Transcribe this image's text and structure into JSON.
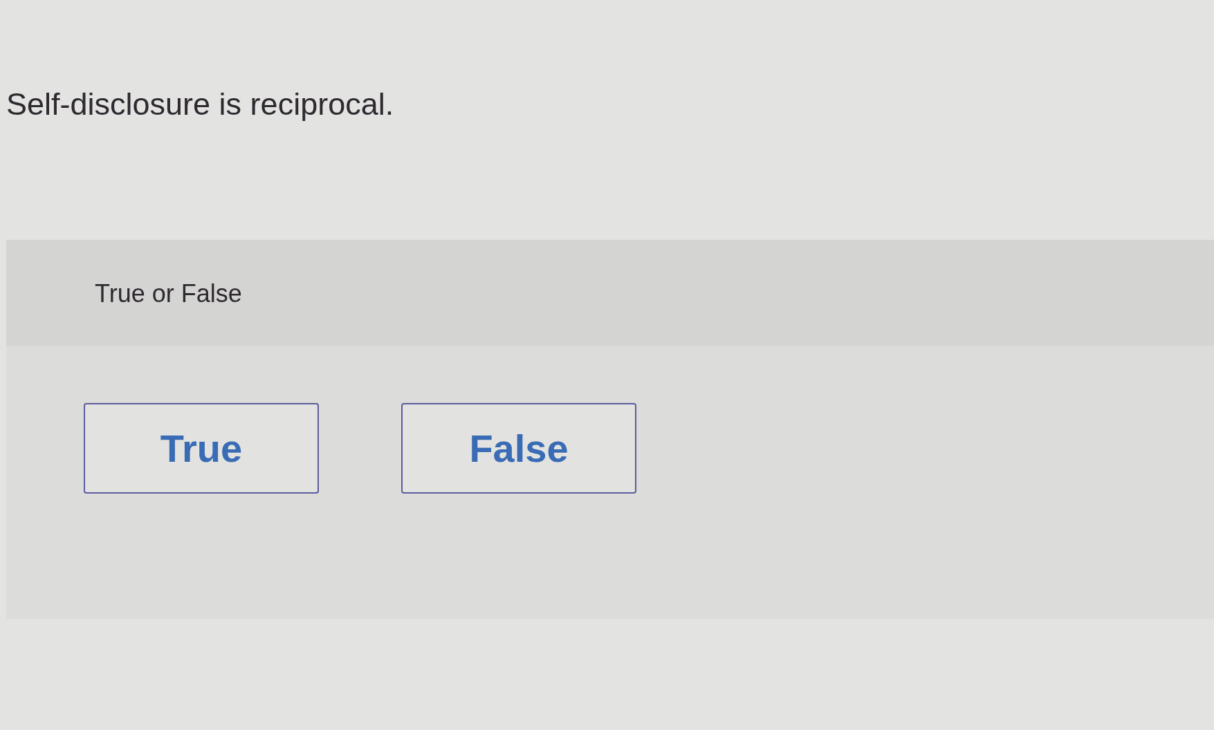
{
  "question": "Self-disclosure is reciprocal.",
  "answer_panel": {
    "prompt": "True or False",
    "options": [
      {
        "label": "True",
        "selected": false
      },
      {
        "label": "False",
        "selected": false
      }
    ]
  }
}
